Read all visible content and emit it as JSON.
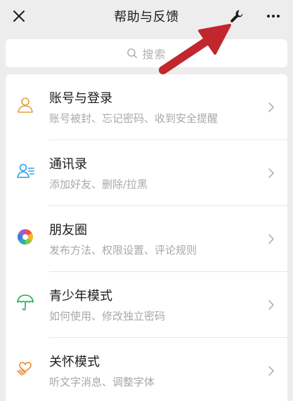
{
  "header": {
    "title": "帮助与反馈",
    "close_icon": "close-icon",
    "tool_icon": "wrench-icon",
    "more_icon": "more-icon"
  },
  "search": {
    "label": "搜索",
    "icon": "search-icon"
  },
  "items": [
    {
      "title": "账号与登录",
      "subtitle": "账号被封、忘记密码、收到安全提醒",
      "icon": "user-icon",
      "color": "#e0a13c"
    },
    {
      "title": "通讯录",
      "subtitle": "添加好友、删除/拉黑",
      "icon": "contacts-icon",
      "color": "#2aa0e0"
    },
    {
      "title": "朋友圈",
      "subtitle": "发布方法、权限设置、评论规则",
      "icon": "moments-icon",
      "color": "#f1533a"
    },
    {
      "title": "青少年模式",
      "subtitle": "如何使用、修改独立密码",
      "icon": "umbrella-icon",
      "color": "#1aad4d"
    },
    {
      "title": "关怀模式",
      "subtitle": "听文字消息、调整字体",
      "icon": "heart-hand-icon",
      "color": "#e88a2a"
    }
  ],
  "colors": {
    "background": "#ededed",
    "arrow": "#c1272d"
  }
}
